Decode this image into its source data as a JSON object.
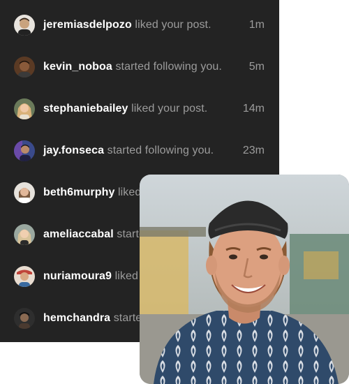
{
  "notifications": [
    {
      "username": "jeremiasdelpozo",
      "action": "liked your post.",
      "time": "1m",
      "avatar_color": "#c9a37e"
    },
    {
      "username": "kevin_noboa",
      "action": "started following you.",
      "time": "5m",
      "avatar_color": "#8a5a3a"
    },
    {
      "username": "stephaniebailey",
      "action": "liked your post.",
      "time": "14m",
      "avatar_color": "#d9b27a"
    },
    {
      "username": "jay.fonseca",
      "action": "started following you.",
      "time": "23m",
      "avatar_color": "#3a4a8a"
    },
    {
      "username": "beth6murphy",
      "action": "liked your post.",
      "time": "",
      "avatar_color": "#caa58a"
    },
    {
      "username": "ameliaccabal",
      "action": "started following you.",
      "time": "",
      "avatar_color": "#d8c39a"
    },
    {
      "username": "nuriamoura9",
      "action": "liked your post.",
      "time": "",
      "avatar_color": "#c0443a"
    },
    {
      "username": "hemchandra",
      "action": "started following you.",
      "time": "",
      "avatar_color": "#4a3a30"
    }
  ],
  "colors": {
    "panel": "#232323",
    "username": "#ffffff",
    "muted": "#9c9c9c"
  }
}
